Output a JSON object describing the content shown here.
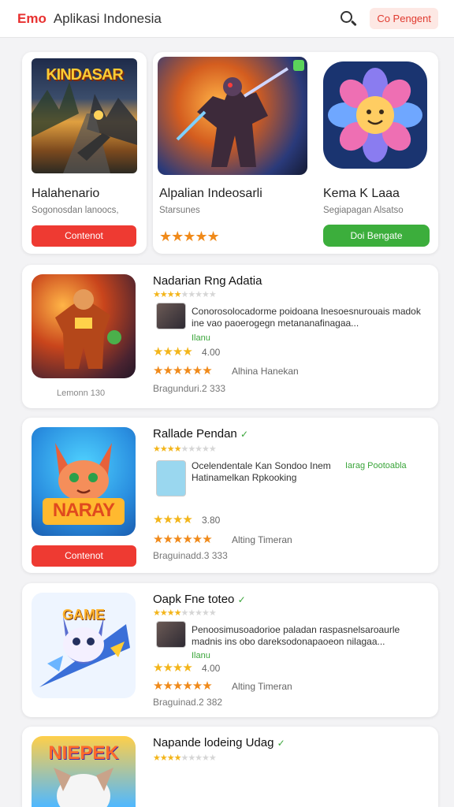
{
  "header": {
    "brand": "Emo",
    "title": "Aplikasi Indonesia",
    "action_label": "Co Pengent"
  },
  "featured": [
    {
      "name": "Halahenario",
      "subtitle": "Sogonosdan lanoocs,",
      "button": "Contenot",
      "art": "art-kindasar",
      "art_text": "KINDASAR"
    },
    {
      "name": "Alpalian Indeosarli",
      "subtitle": "Starsunes",
      "stars": "★★★★★",
      "art": "art-warrior"
    },
    {
      "name": "Kema K Laaa",
      "subtitle": "Segiapagan Alsatso",
      "button": "Doi Bengate",
      "art": "art-flower"
    }
  ],
  "list": [
    {
      "title": "Nadarian Rng Adatia",
      "check": "",
      "desc": "Conorosolocadorme poidoana lnesoesnurouais madok ine vao paoerogegn metananafinagaa...",
      "link": "Ilanu",
      "rating_num": "4.00",
      "rating_label": "Alhina Hanekan",
      "date": "Bragunduri.2 333",
      "caption": "Lemonn 130",
      "button": "",
      "art": "art-robot"
    },
    {
      "title": "Rallade Pendan",
      "check": "✓",
      "desc": "Ocelendentale Kan Sondoo Inem Hatinamelkan Rpkooking",
      "link": "Iarag Pootoabla",
      "rating_num": "3.80",
      "rating_label": "Alting Timeran",
      "date": "Braguinadd.3 333",
      "caption": "",
      "button": "Contenot",
      "art": "art-cat",
      "art_text": "NARAY"
    },
    {
      "title": "Oapk Fne toteo",
      "check": "✓",
      "desc": "Penoosimusoadorioe paladan raspasnelsaroaurle madnis ins obo dareksodonapaoeon nilagaa...",
      "link": "Ilanu",
      "rating_num": "4.00",
      "rating_label": "Alting Timeran",
      "date": "Braguinad.2 382",
      "caption": "",
      "button": "",
      "art": "art-game",
      "art_text": "GAME"
    },
    {
      "title": "Napande lodeing Udag",
      "check": "✓",
      "art": "art-puppy",
      "art_text": "NIEPEK"
    }
  ],
  "colors": {
    "accent": "#e8302f",
    "button_red": "#ee3a32",
    "button_green": "#3cae3c",
    "star": "#f3b51a"
  }
}
